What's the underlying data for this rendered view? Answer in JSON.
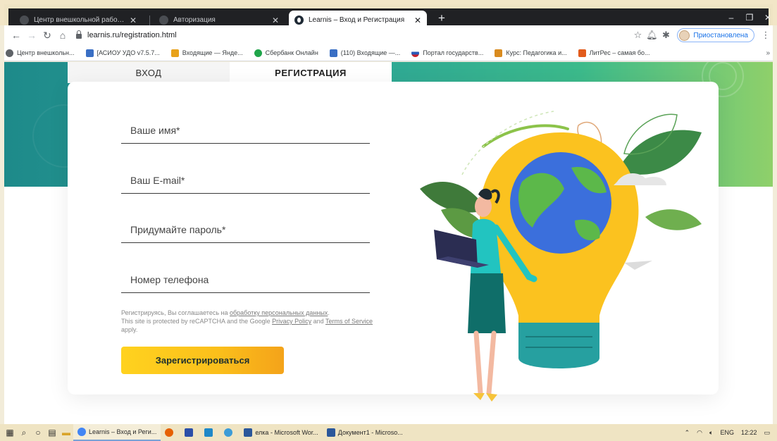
{
  "browser": {
    "tabs": [
      {
        "title": "Центр внешкольной работы «П",
        "active": false
      },
      {
        "title": "Авторизация",
        "active": false
      },
      {
        "title": "Learnis – Вход и Регистрация",
        "active": true
      }
    ],
    "new_tab": "+",
    "window_controls": {
      "minimize": "–",
      "maximize": "❐",
      "close": "✕"
    },
    "url": "learnis.ru/registration.html",
    "profile_label": "Приостановлена",
    "bookmarks": [
      {
        "label": "Центр внешкольн...",
        "color": "#5f6368"
      },
      {
        "label": "[АСИОУ УДО v7.5.7...",
        "color": "#3a6fc4"
      },
      {
        "label": "Входящие — Янде...",
        "color": "#e8a21b"
      },
      {
        "label": "Сбербанк Онлайн",
        "color": "#1fa54a"
      },
      {
        "label": "(110) Входящие —...",
        "color": "#3a6fc4"
      },
      {
        "label": "Портал государств...",
        "color": "#c8202a"
      },
      {
        "label": "Курс: Педагогика и...",
        "color": "#d98b1f"
      },
      {
        "label": "ЛитРес – самая бо...",
        "color": "#e25b1c"
      }
    ],
    "bookmarks_more": "»"
  },
  "auth_tabs": {
    "login": "ВХОД",
    "register": "РЕГИСТРАЦИЯ"
  },
  "form": {
    "name_placeholder": "Ваше имя*",
    "email_placeholder": "Ваш E-mail*",
    "password_placeholder": "Придумайте пароль*",
    "phone_placeholder": "Номер телефона",
    "consent_prefix": "Регистрируясь, Вы соглашаетесь на ",
    "consent_link": "обработку персональных данных",
    "consent_suffix": ".",
    "recaptcha_prefix": "This site is protected by reCAPTCHA and the Google ",
    "privacy_link": "Privacy Policy",
    "recaptcha_and": " and ",
    "terms_link": "Terms of Service",
    "recaptcha_suffix": " apply.",
    "submit_label": "Зарегистрироваться"
  },
  "taskbar": {
    "apps": [
      {
        "label": "Learnis – Вход и Реги...",
        "color": "#4285f4",
        "active": true
      },
      {
        "label": "",
        "color": "#e66000",
        "active": false
      },
      {
        "label": "",
        "color": "#2b4fa8",
        "active": false
      },
      {
        "label": "",
        "color": "#1e88c8",
        "active": false
      },
      {
        "label": "",
        "color": "#3c9cd7",
        "active": false
      },
      {
        "label": "елка - Microsoft Wor...",
        "color": "#2b579a",
        "active": false
      },
      {
        "label": "Документ1 - Microso...",
        "color": "#2b579a",
        "active": false
      }
    ],
    "language": "ENG",
    "time": "12:22"
  }
}
